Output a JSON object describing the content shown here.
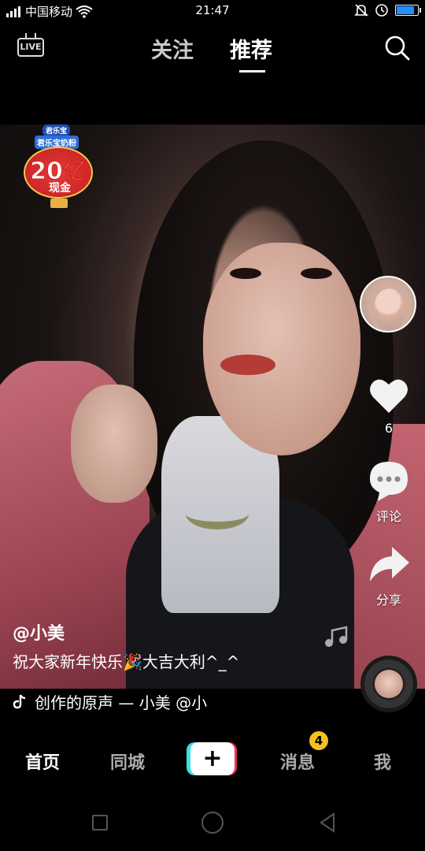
{
  "status_bar": {
    "signal": "4G",
    "carrier": "中国移动",
    "time": "21:47",
    "battery_level": 0.85,
    "icons": [
      "signal-icon",
      "wifi-icon",
      "mute-icon",
      "alarm-icon",
      "battery-icon"
    ]
  },
  "top_nav": {
    "live_label": "LIVE",
    "tabs": [
      "关注",
      "推荐"
    ],
    "active_tab": "推荐",
    "search_icon": "search-icon"
  },
  "promo": {
    "brand": "君乐宝",
    "product": "君乐宝奶粉",
    "amount": "20亿",
    "cash": "现金"
  },
  "actions": {
    "like_count": "6",
    "comment_label": "评论",
    "share_label": "分享"
  },
  "post": {
    "username": "@小美",
    "caption": "祝大家新年快乐🎉大吉大利^_^",
    "music": "创作的原声 — 小美  @小"
  },
  "tabbar": {
    "home": "首页",
    "city": "同城",
    "add": "+",
    "messages": "消息",
    "messages_badge": "4",
    "me": "我"
  },
  "colors": {
    "background": "#000000",
    "badge": "#f4c21a",
    "plus_cyan": "#3fe0e6",
    "plus_red": "#f0305a",
    "battery": "#1e90ff"
  }
}
